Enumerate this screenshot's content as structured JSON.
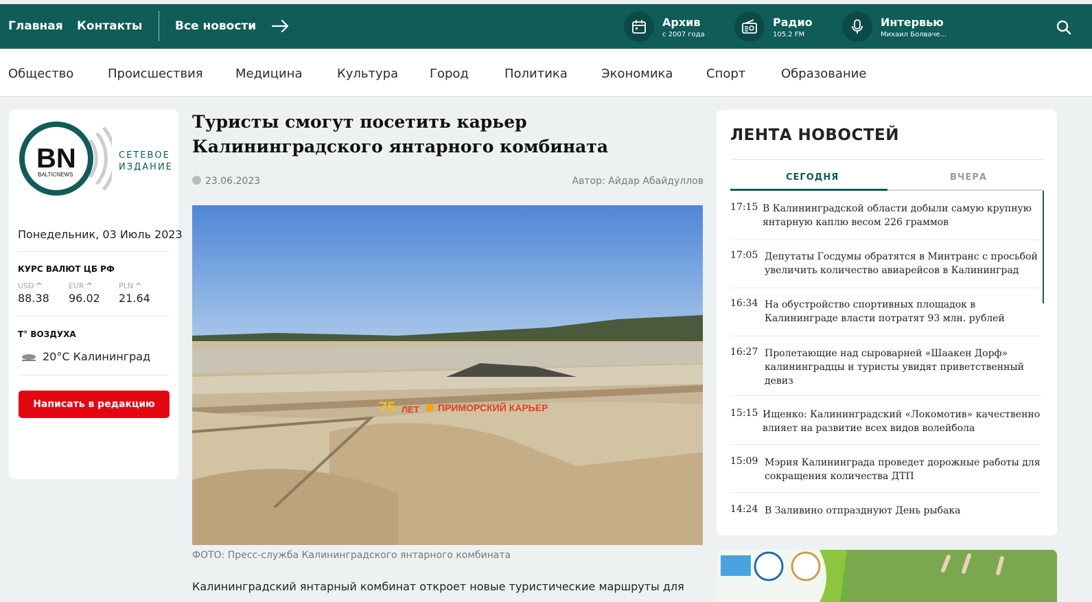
{
  "topbar": {
    "home": "Главная",
    "contacts": "Контакты",
    "all_news": "Все новости",
    "archive": {
      "title": "Архив",
      "sub": "с 2007 года"
    },
    "radio": {
      "title": "Радио",
      "sub": "105.2 FM"
    },
    "interview": {
      "title": "Интервью",
      "sub": "Михаил Болваче..."
    }
  },
  "categories": [
    "Общество",
    "Происшествия",
    "Медицина",
    "Культура",
    "Город",
    "Политика",
    "Экономика",
    "Спорт",
    "Образование"
  ],
  "sidebar": {
    "logo_letters": "BN",
    "logo_small": "BALTICNEWS",
    "tagline_1": "СЕТЕВОЕ",
    "tagline_2": "ИЗДАНИЕ",
    "date": "Понедельник, 03 Июль 2023",
    "currency_title": "КУРС ВАЛЮТ ЦБ РФ",
    "currencies": [
      {
        "code": "USD",
        "value": "88.38"
      },
      {
        "code": "EUR",
        "value": "96.02"
      },
      {
        "code": "PLN",
        "value": "21.64"
      }
    ],
    "weather_title": "T° ВОЗДУХА",
    "weather": "20°C Калининград",
    "write_button": "Написать в редакцию"
  },
  "article": {
    "title": "Туристы смогут посетить карьер Калининградского янтарного комбината",
    "date": "23.06.2023",
    "author": "Автор: Айдар Абайдуллов",
    "photo_sign_number": "75",
    "photo_sign_text": "ЛЕТ",
    "photo_sign_name": "ПРИМОРСКИЙ КАРЬЕР",
    "caption": "ФОТО: Пресс-служба Калининградского янтарного комбината",
    "lead": "Калининградский янтарный комбинат откроет новые туристические маршруты для"
  },
  "feed": {
    "title": "ЛЕНТА НОВОСТЕЙ",
    "tab_today": "СЕГОДНЯ",
    "tab_yesterday": "ВЧЕРА",
    "items": [
      {
        "time": "17:15",
        "text": "В Калининградской области добыли самую крупную янтарную каплю весом 226 граммов"
      },
      {
        "time": "17:05",
        "text": "Депутаты Госдумы обратятся в Минтранс с просьбой увеличить количество авиарейсов в Калининград"
      },
      {
        "time": "16:34",
        "text": "На обустройство спортивных площадок в Калининграде власти потратят 93 млн. рублей"
      },
      {
        "time": "16:27",
        "text": "Пролетающие над сыроварней «Шаакен Дорф» калининградцы и туристы увидят приветственный девиз"
      },
      {
        "time": "15:15",
        "text": "Ищенко: Калининградский «Локомотив» качественно влияет на развитие всех видов волейбола"
      },
      {
        "time": "15:09",
        "text": "Мэрия Калининграда проведет дорожные работы для сокращения количества ДТП"
      },
      {
        "time": "14:24",
        "text": "В Заливино отпразднуют День рыбака"
      }
    ]
  },
  "colors": {
    "brand": "#0f5c58",
    "accent_red": "#e30613",
    "up_green": "#1aa35a"
  }
}
